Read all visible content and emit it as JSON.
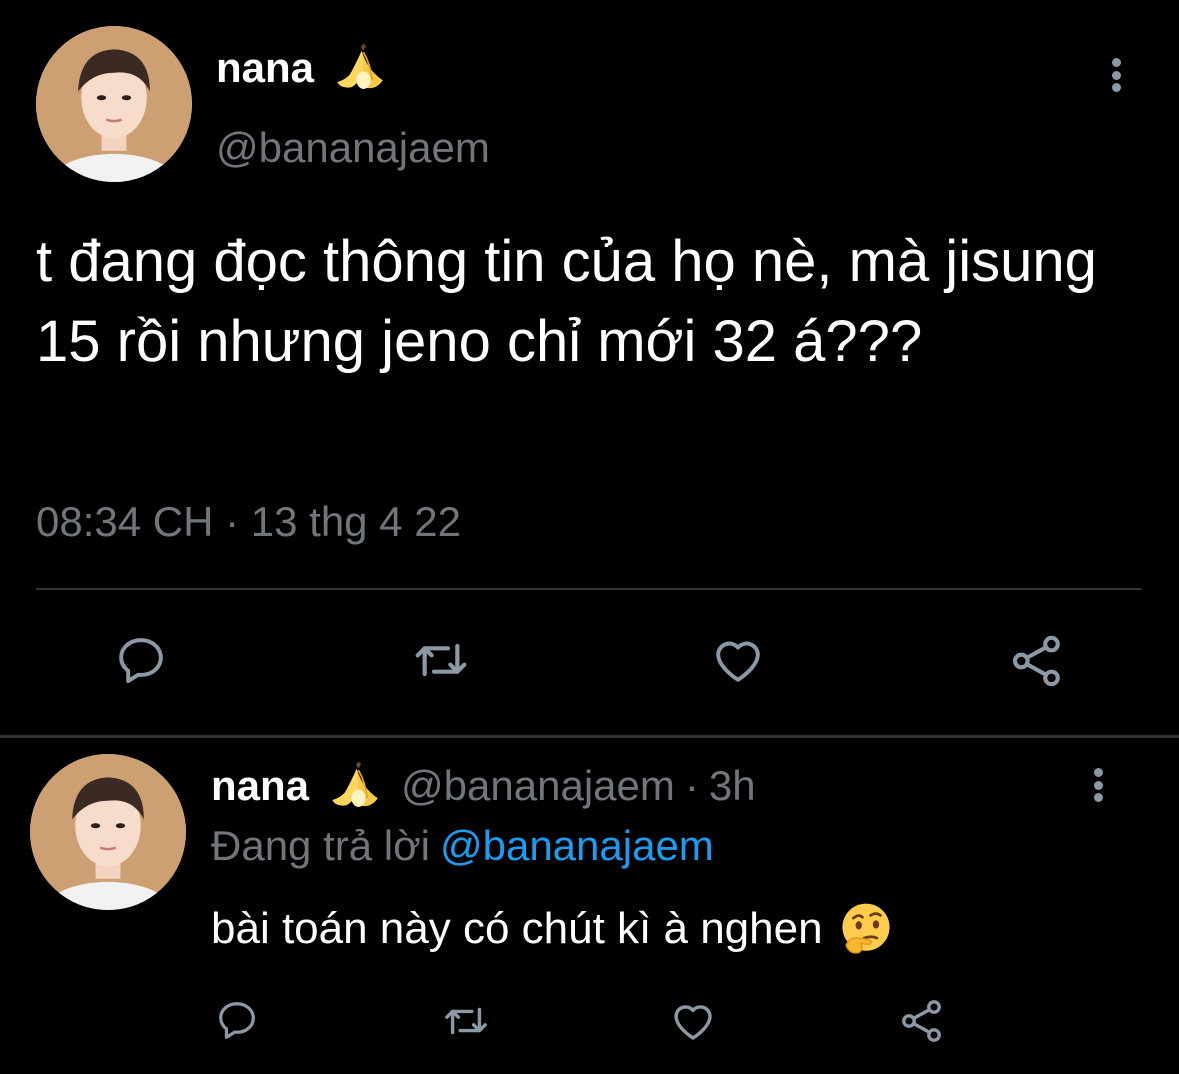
{
  "main_tweet": {
    "display_name": "nana",
    "name_emoji": "banana-emoji",
    "handle": "@bananajaem",
    "text": "t đang đọc thông tin của họ nè, mà jisung 15 rồi nhưng jeno chỉ mới 32 á???",
    "timestamp": "08:34 CH · 13 thg 4 22",
    "actions": [
      "reply-icon",
      "retweet-icon",
      "like-icon",
      "share-icon"
    ]
  },
  "reply_tweet": {
    "display_name": "nana",
    "name_emoji": "banana-emoji",
    "handle": "@bananajaem",
    "separator": "·",
    "relative_time": "3h",
    "replying_label": "Đang trả lời",
    "replying_to": "@bananajaem",
    "text": "bài toán này có chút kì à nghen",
    "text_emoji": "thinking-face-emoji",
    "actions": [
      "reply-icon",
      "retweet-icon",
      "like-icon",
      "share-icon"
    ]
  },
  "colors": {
    "background": "#000000",
    "primary_text": "#ffffff",
    "secondary_text": "#71767b",
    "icon": "#8b98a5",
    "link": "#1d9bf0",
    "divider": "#2f3336"
  }
}
